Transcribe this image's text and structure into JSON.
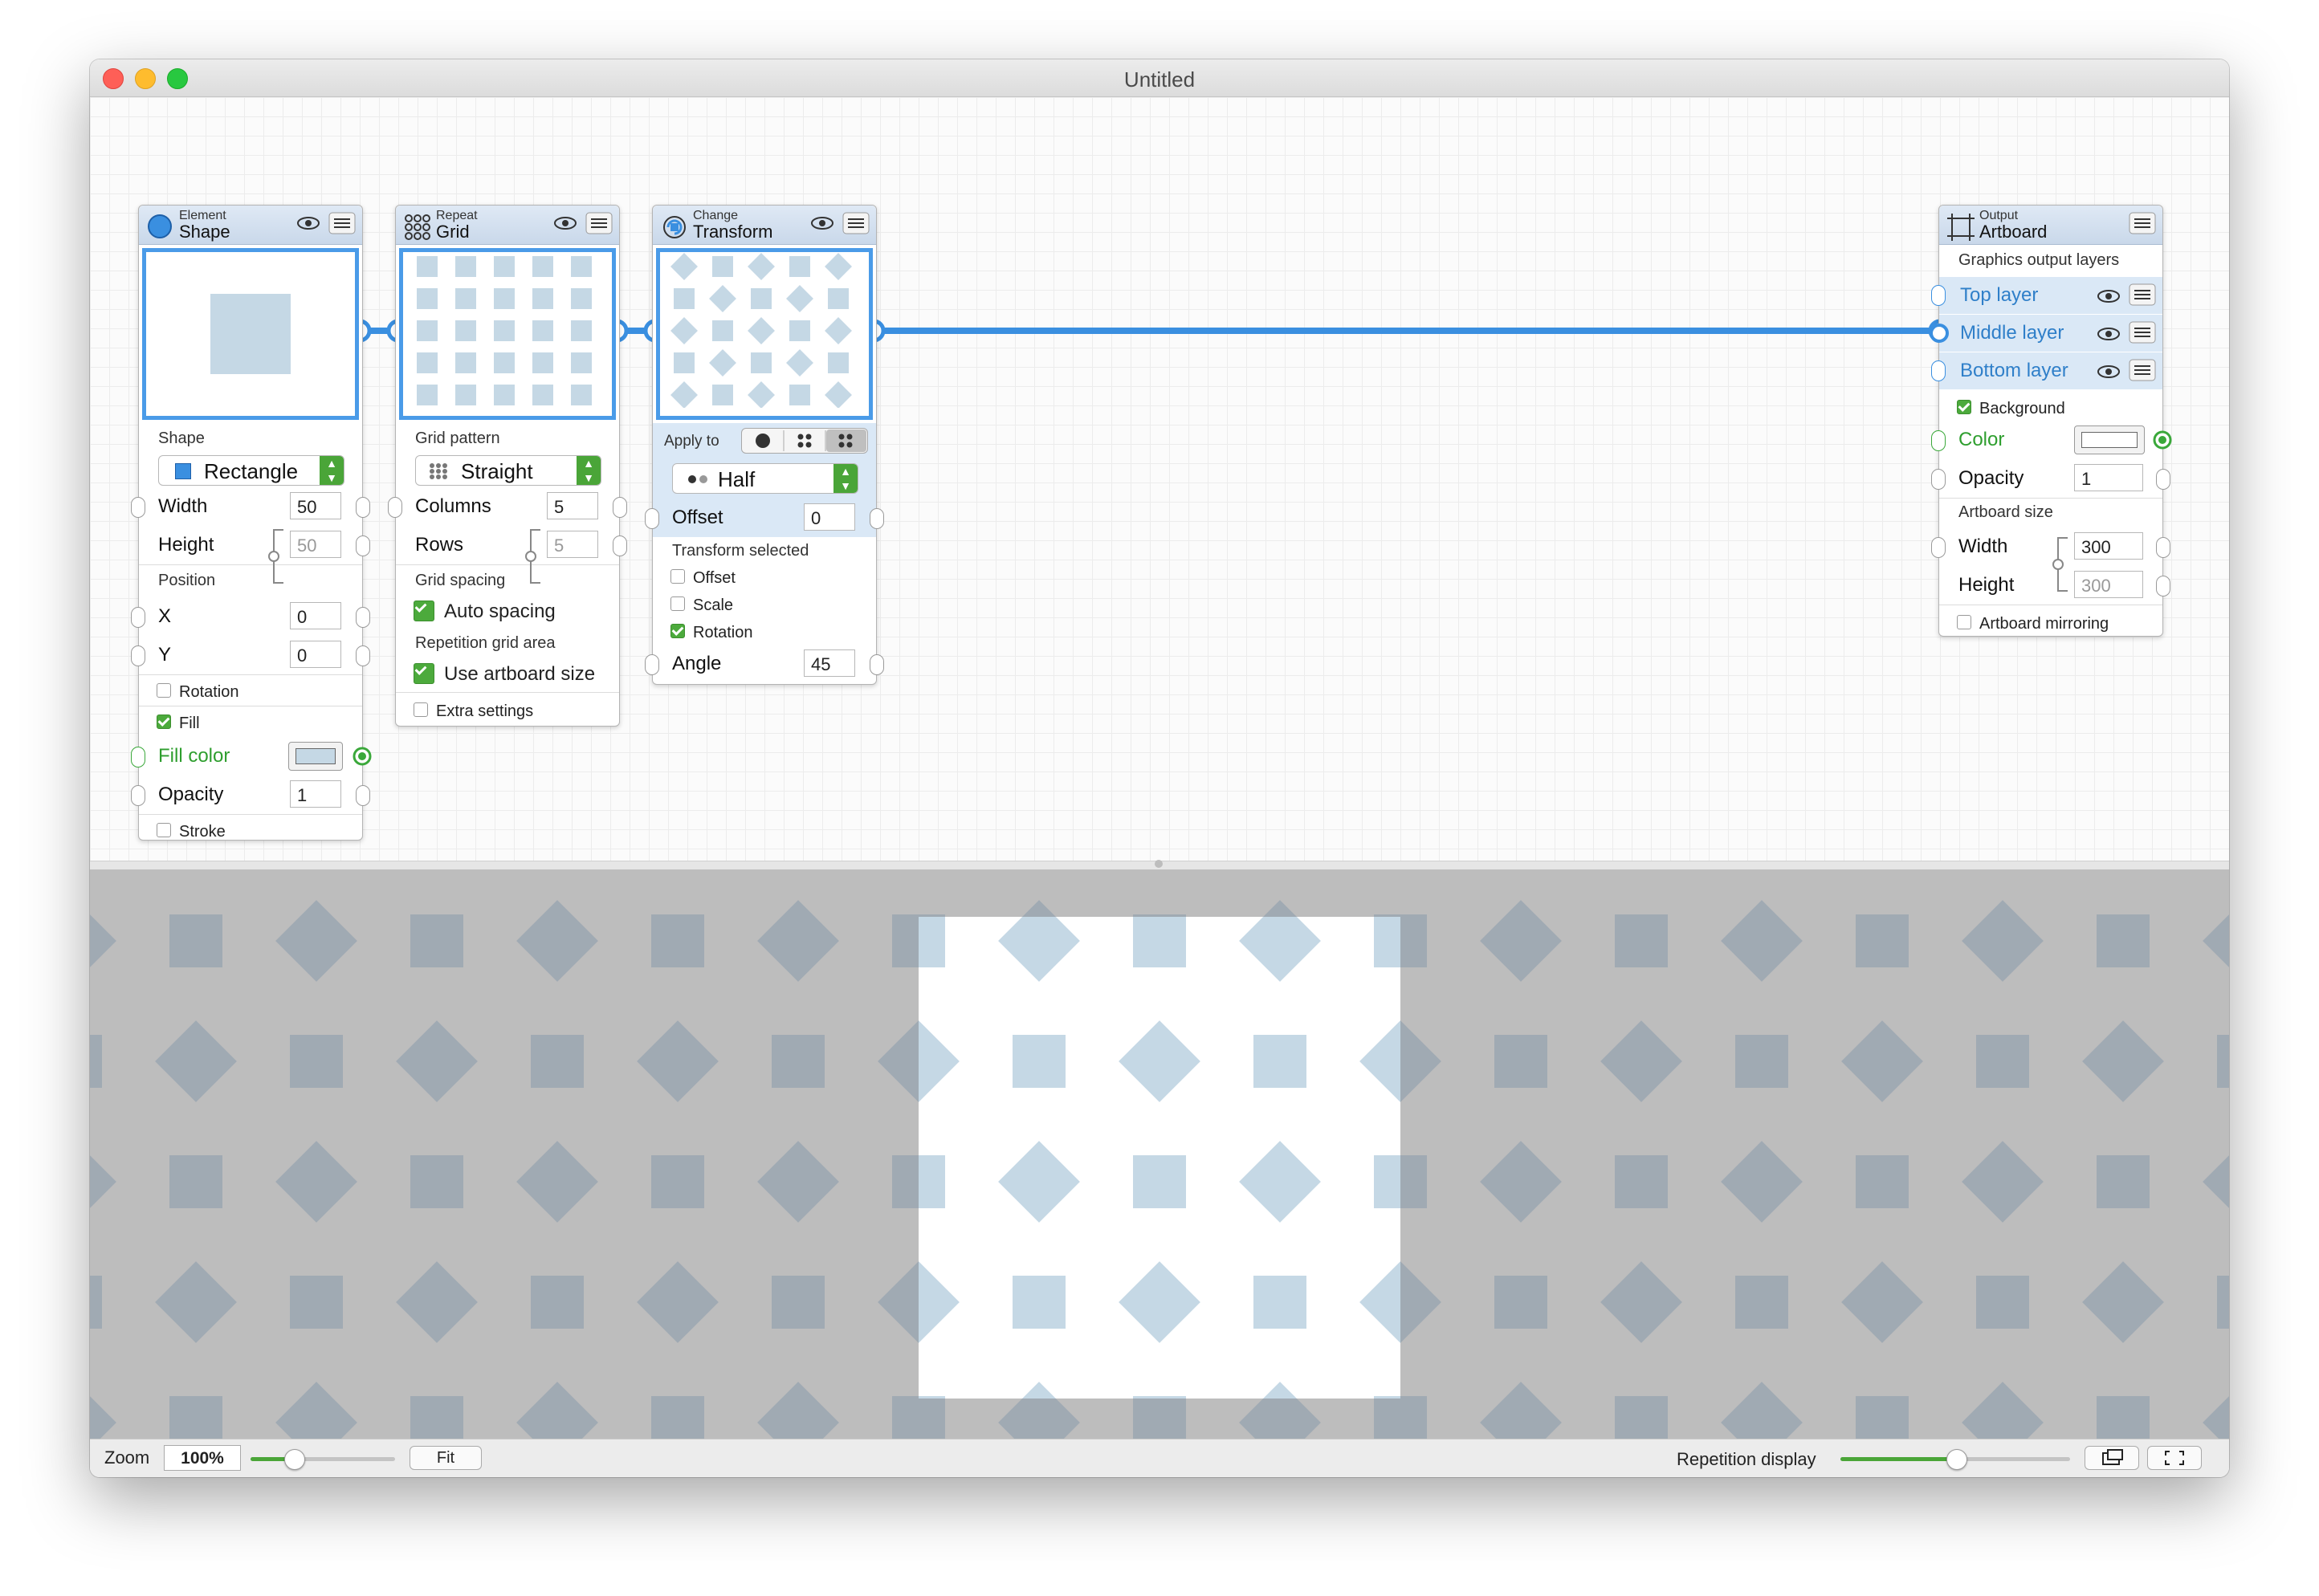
{
  "window": {
    "title": "Untitled"
  },
  "nodes": {
    "shape": {
      "category": "Element",
      "name": "Shape",
      "shape_section": "Shape",
      "shape_value": "Rectangle",
      "width_label": "Width",
      "width_value": "50",
      "height_label": "Height",
      "height_value": "50",
      "position_section": "Position",
      "x_label": "X",
      "x_value": "0",
      "y_label": "Y",
      "y_value": "0",
      "rotation_label": "Rotation",
      "rotation_checked": false,
      "fill_label": "Fill",
      "fill_checked": true,
      "fill_color_label": "Fill color",
      "opacity_label": "Opacity",
      "opacity_value": "1",
      "stroke_label": "Stroke",
      "stroke_checked": false
    },
    "grid": {
      "category": "Repeat",
      "name": "Grid",
      "pattern_section": "Grid pattern",
      "pattern_value": "Straight",
      "columns_label": "Columns",
      "columns_value": "5",
      "rows_label": "Rows",
      "rows_value": "5",
      "spacing_section": "Grid spacing",
      "auto_spacing_label": "Auto spacing",
      "auto_spacing_checked": true,
      "area_section": "Repetition grid area",
      "artboard_size_label": "Use artboard size",
      "artboard_size_checked": true,
      "extra_label": "Extra settings",
      "extra_checked": false
    },
    "transform": {
      "category": "Change",
      "name": "Transform",
      "apply_to_label": "Apply to",
      "apply_value": "Half",
      "offset_label": "Offset",
      "offset_value": "0",
      "transform_selected_section": "Transform selected",
      "opt_offset": "Offset",
      "opt_scale": "Scale",
      "opt_rotation": "Rotation",
      "angle_label": "Angle",
      "angle_value": "45"
    },
    "artboard": {
      "category": "Output",
      "name": "Artboard",
      "layers_section": "Graphics output layers",
      "layers": [
        {
          "label": "Top layer"
        },
        {
          "label": "Middle layer"
        },
        {
          "label": "Bottom layer"
        }
      ],
      "background_label": "Background",
      "background_checked": true,
      "color_label": "Color",
      "opacity_label": "Opacity",
      "opacity_value": "1",
      "size_section": "Artboard size",
      "width_label": "Width",
      "width_value": "300",
      "height_label": "Height",
      "height_value": "300",
      "mirroring_label": "Artboard mirroring",
      "mirroring_checked": false
    }
  },
  "bottom_bar": {
    "zoom_label": "Zoom",
    "zoom_value": "100%",
    "fit_label": "Fit",
    "repetition_label": "Repetition display"
  },
  "colors": {
    "accent_blue": "#4a9be8",
    "shape_fill": "#c5d8e5",
    "preview_bg": "#bdbdbd",
    "pattern_grey": "#a0aab3",
    "green": "#4aa538"
  }
}
